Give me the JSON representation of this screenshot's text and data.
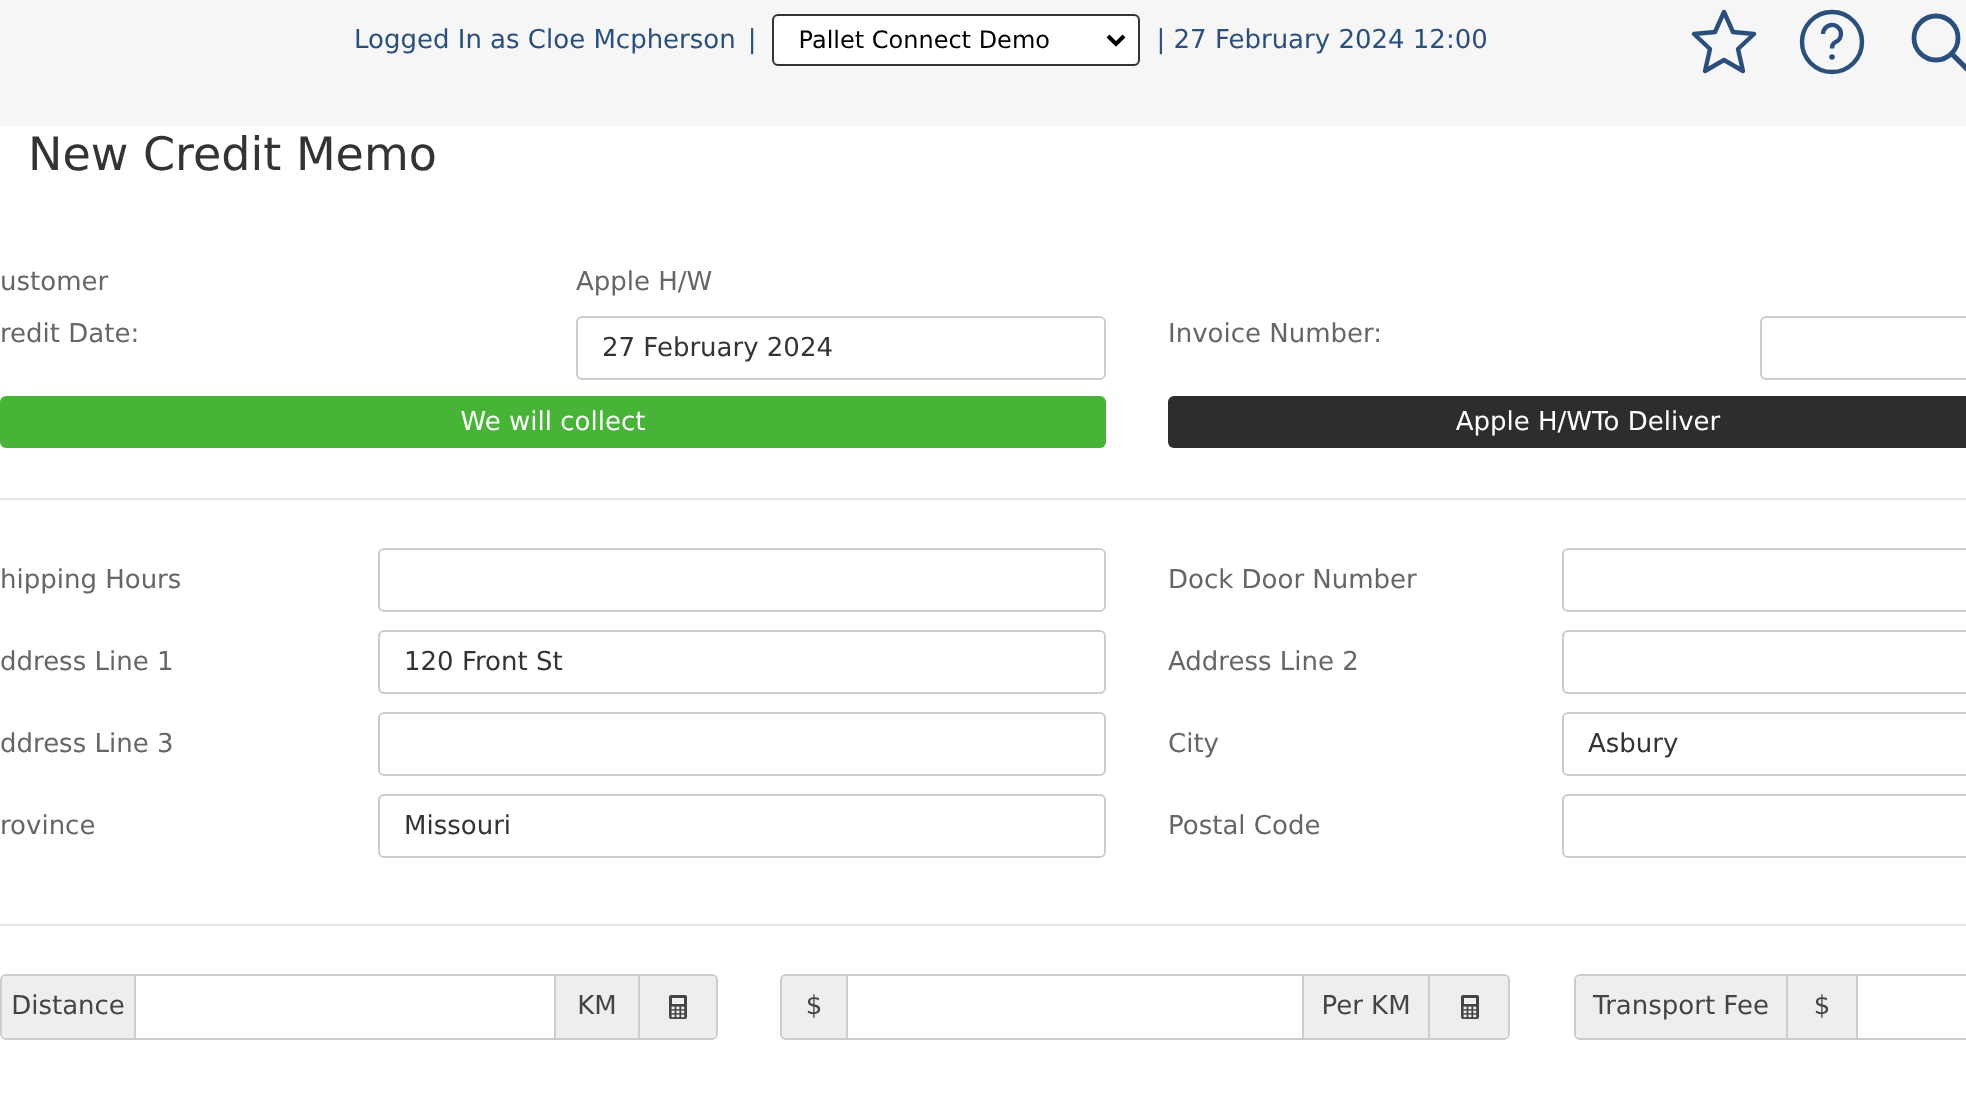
{
  "header": {
    "user_text": "Logged In as Cloe Mcpherson",
    "separator": "|",
    "company_select": {
      "value": "Pallet Connect Demo"
    },
    "datetime": "| 27 February 2024 12:00"
  },
  "page_title": "New Credit Memo",
  "customer": {
    "label": "ustomer",
    "value": "Apple H/W"
  },
  "credit_date": {
    "label": "redit Date:",
    "value": "27 February 2024"
  },
  "invoice_number": {
    "label": "Invoice Number:"
  },
  "delivery_buttons": [
    {
      "label": "We will collect",
      "selected": true
    },
    {
      "label": "Apple H/WTo Deliver",
      "selected": false
    }
  ],
  "address_rows": [
    {
      "left": {
        "label": "hipping Hours"
      },
      "right": {
        "label": "Dock Door Number"
      }
    },
    {
      "left": {
        "label": "ddress Line 1",
        "value": "120 Front St"
      },
      "right": {
        "label": "Address Line 2"
      }
    },
    {
      "left": {
        "label": "ddress Line 3"
      },
      "right": {
        "label": "City",
        "value": "Asbury"
      }
    },
    {
      "left": {
        "label": "rovince",
        "value": "Missouri"
      },
      "right": {
        "label": "Postal Code"
      }
    }
  ],
  "cost_groups": [
    [
      {
        "kind": "addon",
        "text": "Distance"
      },
      {
        "kind": "input"
      },
      {
        "kind": "addon",
        "text": "KM"
      },
      {
        "kind": "calc"
      }
    ],
    [
      {
        "kind": "addon",
        "text": "$"
      },
      {
        "kind": "input"
      },
      {
        "kind": "addon",
        "text": "Per KM"
      },
      {
        "kind": "calc"
      }
    ],
    [
      {
        "kind": "addon",
        "text": "Transport Fee"
      },
      {
        "kind": "addon",
        "text": "$"
      },
      {
        "kind": "input"
      }
    ]
  ]
}
